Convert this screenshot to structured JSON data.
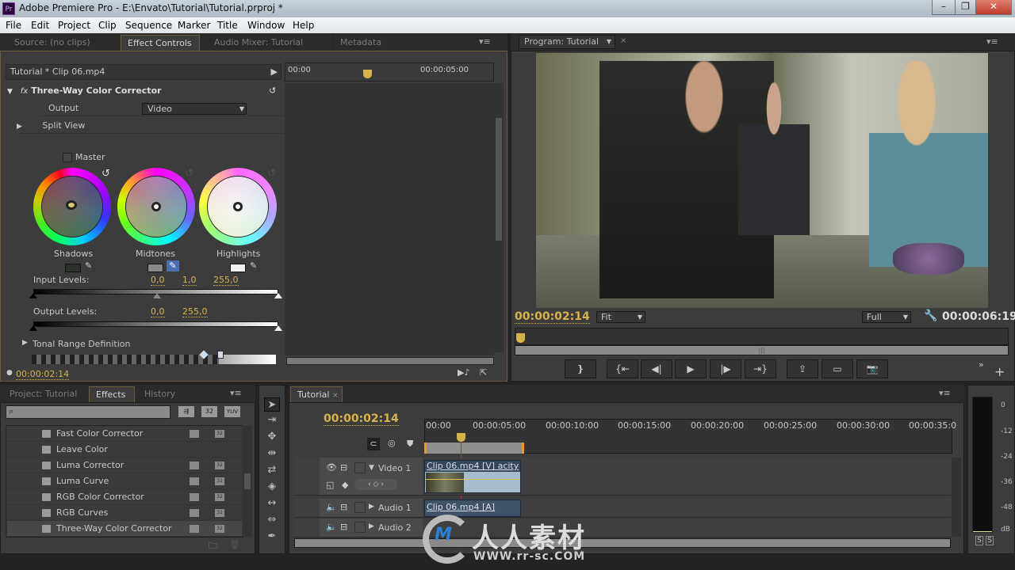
{
  "window": {
    "title": "Adobe Premiere Pro - E:\\Envato\\Tutorial\\Tutorial.prproj *",
    "app_icon": "Pr",
    "controls": [
      "minimize",
      "restore",
      "close"
    ]
  },
  "menu": [
    "File",
    "Edit",
    "Project",
    "Clip",
    "Sequence",
    "Marker",
    "Title",
    "Window",
    "Help"
  ],
  "source_panel": {
    "tabs": [
      "Source: (no clips)",
      "Effect Controls",
      "Audio Mixer: Tutorial",
      "Metadata"
    ],
    "active_tab": "Effect Controls"
  },
  "effect_controls": {
    "clip_label": "Tutorial * Clip 06.mp4",
    "ruler_start": "00:00",
    "ruler_mid": "00:00:05:00",
    "effect_name": "Three-Way Color Corrector",
    "fx_label": "fx",
    "output_label": "Output",
    "output_value": "Video",
    "split_view_label": "Split View",
    "master_label": "Master",
    "wheels": [
      {
        "label": "Shadows",
        "swatch_color": "#2a302a"
      },
      {
        "label": "Midtones",
        "swatch_color": "#8a8a8a"
      },
      {
        "label": "Highlights",
        "swatch_color": "#efefef"
      }
    ],
    "input_levels_label": "Input Levels:",
    "input_levels": [
      "0,0",
      "1,0",
      "255,0"
    ],
    "output_levels_label": "Output Levels:",
    "output_levels": [
      "0,0",
      "255,0"
    ],
    "tonal_range_label": "Tonal Range Definition",
    "timecode": "00:00:02:14"
  },
  "program_monitor": {
    "tab_label": "Program: Tutorial",
    "timecode_current": "00:00:02:14",
    "zoom_value": "Fit",
    "resolution_value": "Full",
    "timecode_duration": "00:00:06:19",
    "transport": [
      "mark-in",
      "go-to-in",
      "step-back",
      "play",
      "step-forward",
      "go-to-out",
      "export",
      "safe-margins",
      "export-frame"
    ]
  },
  "project_panel": {
    "tabs": [
      "Project: Tutorial",
      "Effects",
      "History"
    ],
    "active_tab": "Effects",
    "search_placeholder": "",
    "filter_badges": [
      "accelerated",
      "32",
      "YUV"
    ],
    "effects": [
      {
        "name": "Fast Color Corrector",
        "badges": true
      },
      {
        "name": "Leave Color",
        "badges": false
      },
      {
        "name": "Luma Corrector",
        "badges": true
      },
      {
        "name": "Luma Curve",
        "badges": true
      },
      {
        "name": "RGB Color Corrector",
        "badges": true
      },
      {
        "name": "RGB Curves",
        "badges": true
      },
      {
        "name": "Three-Way Color Corrector",
        "badges": true
      }
    ]
  },
  "timeline": {
    "tab_label": "Tutorial",
    "timecode": "00:00:02:14",
    "ruler": [
      "00:00",
      "00:00:05:00",
      "00:00:10:00",
      "00:00:15:00",
      "00:00:20:00",
      "00:00:25:00",
      "00:00:30:00",
      "00:00:35:0"
    ],
    "tracks": [
      {
        "name": "Video 1",
        "clip": "Clip 06.mp4 [V]",
        "clip_menu": "acity"
      },
      {
        "name": "Audio 1",
        "clip": "Clip 06.mp4 [A]"
      },
      {
        "name": "Audio 2",
        "clip": ""
      }
    ]
  },
  "audio_meter": {
    "scale": [
      "0",
      "-12",
      "-24",
      "-36",
      "-48",
      "dB"
    ],
    "solo_buttons": [
      "S",
      "S"
    ]
  },
  "watermark": {
    "text": "人人素材",
    "url": "WWW.rr-sc.COM"
  }
}
